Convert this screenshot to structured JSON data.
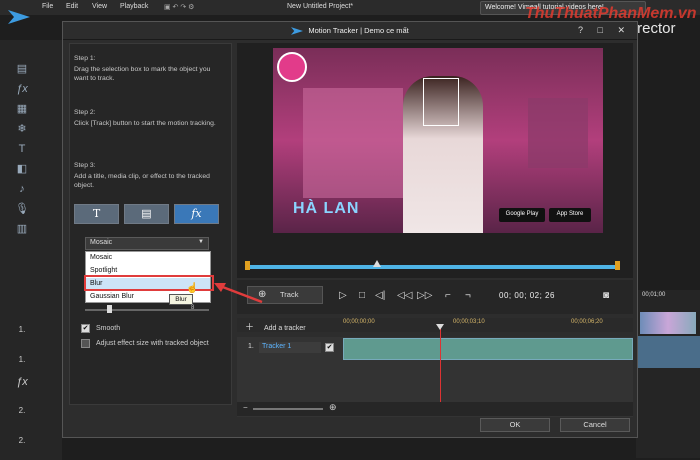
{
  "app": {
    "menu": [
      "File",
      "Edit",
      "View",
      "Playback"
    ],
    "project_title": "New Untitled Project*",
    "brand": "rDirector",
    "notice": "Welcome! Vimeall tutorial videos here!",
    "watermark": "ThuThuatPhanMem.vn",
    "ruler_right": "00;01;00",
    "track_numbers": [
      "1.",
      "1.",
      "2.",
      "2."
    ]
  },
  "dialog": {
    "title": "Motion Tracker",
    "subtitle": "Demo ce mất",
    "title_sep": "|",
    "title_buttons": "? □ ✕"
  },
  "steps": {
    "step1_title": "Step 1:",
    "step1_text": "Drag the selection box to mark the object you want to track.",
    "step2_title": "Step 2:",
    "step2_text": "Click [Track] button to start the motion tracking.",
    "step3_title": "Step 3:",
    "step3_text": "Add a title, media clip, or effect to the tracked object."
  },
  "effect": {
    "selected": "Mosaic",
    "options": [
      "Mosaic",
      "Spotlight",
      "Blur",
      "Gaussian Blur"
    ],
    "hovered": "Blur",
    "tooltip": "Blur",
    "slider_max": "8"
  },
  "options": {
    "smooth_label": "Smooth",
    "smooth_checked": "✔",
    "adjust_label": "Adjust effect size with tracked object"
  },
  "preview": {
    "video_text_left": "HÀ LAN",
    "badge_google": "Google Play",
    "badge_apple": "App Store"
  },
  "controls": {
    "track_label": "Track",
    "timecode": "00; 00; 02; 26"
  },
  "timeline": {
    "add_tracker": "Add a tracker",
    "ruler": [
      "00;00;00;00",
      "00;00;03;10",
      "00;00;06;20"
    ],
    "tracker_index": "1.",
    "tracker_label": "Tracker 1"
  },
  "buttons": {
    "ok": "OK",
    "cancel": "Cancel"
  },
  "colors": {
    "accent": "#4fb4e6",
    "highlight": "#e03c3c",
    "tracker_text": "#5db5ff"
  }
}
